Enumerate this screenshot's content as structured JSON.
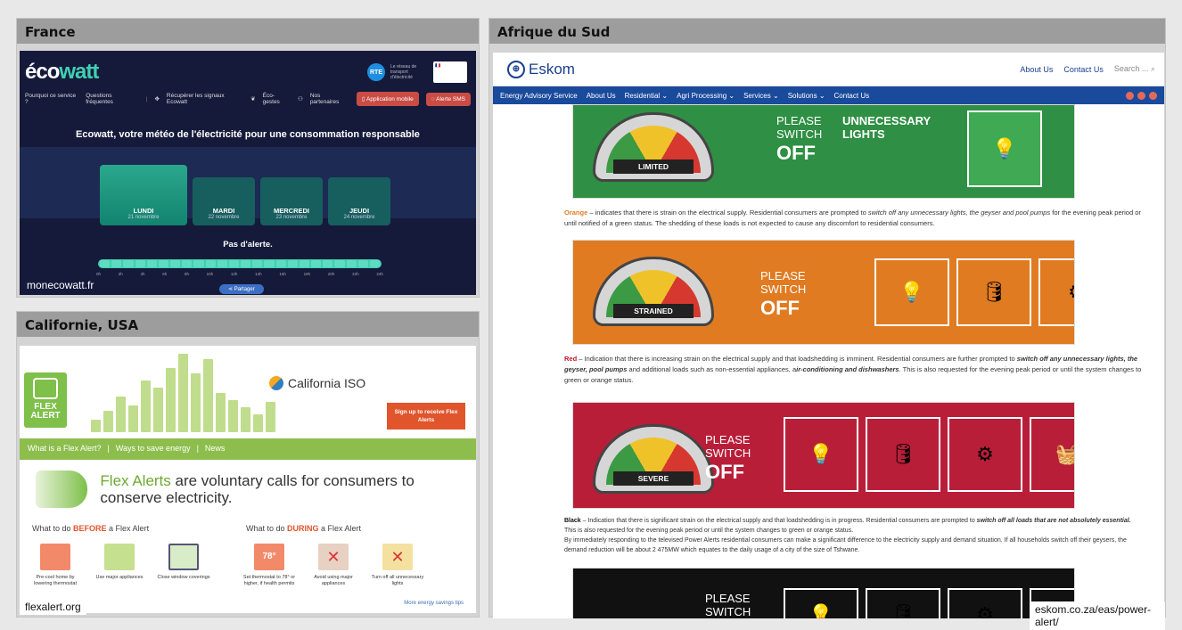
{
  "panels": {
    "france": {
      "title": "France",
      "caption": "monecowatt.fr",
      "logo": {
        "prefix": "éco",
        "suffix": "watt"
      },
      "badge_rte": "RTE",
      "badge_gov": "Le réseau de transport d'électricité",
      "nav": [
        "Pourquoi ce service ?",
        "Questions fréquentes",
        "Récupérer les signaux Ecowatt",
        "Éco-gestes",
        "Nos partenaires"
      ],
      "btn_app": "Application mobile",
      "btn_sms": "Alerte SMS",
      "headline": "Ecowatt, votre météo de l'électricité pour une consommation responsable",
      "days": [
        {
          "name": "LUNDI",
          "date": "21 novembre"
        },
        {
          "name": "MARDI",
          "date": "22 novembre"
        },
        {
          "name": "MERCREDI",
          "date": "23 novembre"
        },
        {
          "name": "JEUDI",
          "date": "24 novembre"
        }
      ],
      "status": "Pas d'alerte.",
      "hours": [
        "0h",
        "2h",
        "4h",
        "6h",
        "8h",
        "10h",
        "12h",
        "14h",
        "16h",
        "18h",
        "20h",
        "22h",
        "24h"
      ],
      "share": "Partager"
    },
    "california": {
      "title": "Californie, USA",
      "caption": "flexalert.org",
      "logo_line1": "FLEX",
      "logo_line2": "ALERT",
      "caiso": "California ISO",
      "signup": "Sign up to receive Flex Alerts",
      "nav": [
        "What is a Flex Alert?",
        "|",
        "Ways to save energy",
        "|",
        "News"
      ],
      "hero_highlight": "Flex Alerts",
      "hero_rest": " are voluntary calls for consumers to conserve electricity.",
      "before_prefix": "What to do ",
      "before_em": "BEFORE",
      "before_suffix": " a Flex Alert",
      "during_prefix": "What to do ",
      "during_em": "DURING",
      "during_suffix": " a Flex Alert",
      "tips_before": [
        "Pre-cool home by lowering thermostat",
        "Use major appliances",
        "Close window coverings"
      ],
      "tips_during": [
        "Set thermostat to 78° or higher, if health permits",
        "Avoid using major appliances",
        "Turn off all unnecessary lights"
      ],
      "thermo_value": "78°",
      "more": "More energy savings tips"
    },
    "south_africa": {
      "title": "Afrique du Sud",
      "caption": "eskom.co.za/eas/power-alert/",
      "brand": "Eskom",
      "top_links": [
        "About Us",
        "Contact Us"
      ],
      "search_placeholder": "Search ...",
      "nav": [
        "Energy Advisory Service",
        "About Us",
        "Residential ⌄",
        "Agri Processing ⌄",
        "Services ⌄",
        "Solutions ⌄",
        "Contact Us"
      ],
      "please": "PLEASE",
      "switch": "SWITCH",
      "off": "OFF",
      "green_extra": "UNNECESSARY LIGHTS",
      "gauges": [
        "LIMITED",
        "STRAINED",
        "SEVERE"
      ],
      "colors": {
        "green": "#2f8f44",
        "orange": "#e07b22",
        "red": "#b81e38",
        "black": "#111111",
        "nav": "#1a4a9c"
      },
      "orange_label": "Orange",
      "orange_text1": " – indicates that there is strain on the electrical supply. Residential consumers are prompted to ",
      "orange_em": "switch off any unnecessary lights, the geyser and pool pumps",
      "orange_text2": " for the evening peak period or until notified of a green status. The shedding of these loads is not expected to cause any discomfort to residential consumers.",
      "red_label": "Red",
      "red_text1": " – Indication that there is increasing strain on the electrical supply and that loadshedding is imminent. Residential consumers are further prompted to ",
      "red_em": "switch off any unnecessary lights, the geyser, pool pumps",
      "red_text2": " and additional loads such as non-essential appliances, a",
      "red_em2": "ir-conditioning and dishwashers",
      "red_text3": ". This is also requested for the evening peak period or until the system changes to green or orange status.",
      "black_label": "Black",
      "black_text1": " – Indication that there is significant strain on the electrical supply and that loadshedding is in progress. Residential consumers are prompted to ",
      "black_em": "switch off all loads that are not absolutely essential.",
      "black_text2": " This is also requested for the evening peak period or until the system changes to green or orange status.",
      "black_text3": "By immediately responding to the televised Power Alerts residential consumers can make a significant difference to the electricity supply and demand situation. If all households switch off their geysers, the demand reduction will be about 2 475MW which equates to the daily usage of a city of the size of Tshwane."
    }
  }
}
